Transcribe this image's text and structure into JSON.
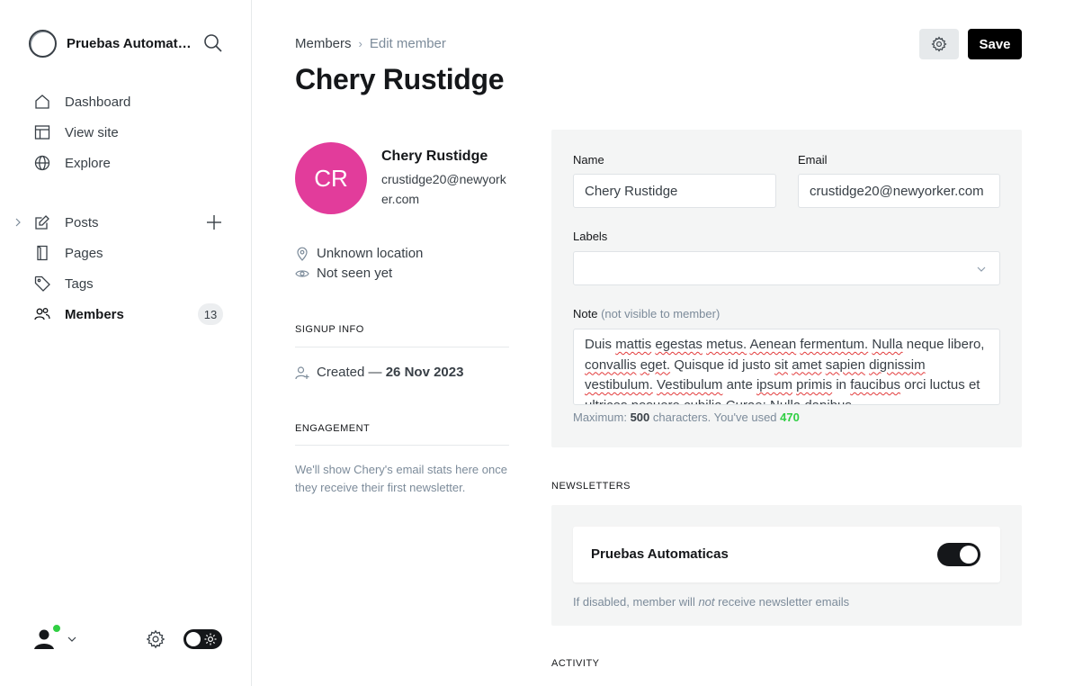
{
  "sidebar": {
    "site_name": "Pruebas Automaticas",
    "nav_primary": [
      {
        "label": "Dashboard",
        "icon": "home-icon"
      },
      {
        "label": "View site",
        "icon": "layout-icon"
      },
      {
        "label": "Explore",
        "icon": "globe-icon"
      }
    ],
    "nav_secondary": [
      {
        "label": "Posts",
        "icon": "pen-icon"
      },
      {
        "label": "Pages",
        "icon": "page-icon"
      },
      {
        "label": "Tags",
        "icon": "tag-icon"
      },
      {
        "label": "Members",
        "icon": "members-icon",
        "count": "13",
        "active": true
      }
    ]
  },
  "header": {
    "breadcrumb_parent": "Members",
    "breadcrumb_separator": "›",
    "breadcrumb_current": "Edit member",
    "title": "Chery Rustidge",
    "save_label": "Save"
  },
  "member": {
    "initials": "CR",
    "avatar_color": "#e23c9b",
    "name": "Chery Rustidge",
    "email": "crustidge20@newyorker.com",
    "location": "Unknown location",
    "last_seen": "Not seen yet",
    "signup_section": "SIGNUP INFO",
    "created_prefix": "Created —",
    "created_date": "26 Nov 2023",
    "engagement_section": "ENGAGEMENT",
    "engagement_text": "We'll show Chery's email stats here once they receive their first newsletter."
  },
  "form": {
    "name_label": "Name",
    "name_value": "Chery Rustidge",
    "email_label": "Email",
    "email_value": "crustidge20@newyorker.com",
    "labels_label": "Labels",
    "note_label": "Note",
    "note_hint": "(not visible to member)",
    "note_value": "Duis mattis egestas metus. Aenean fermentum. Nulla neque libero, convallis eget. Quisque id justo sit amet sapien dignissim vestibulum. Vestibulum ante ipsum primis in faucibus orci luctus et ultrices posuere cubilia Curae; Nulla dapibus",
    "counter_prefix": "Maximum:",
    "counter_max": "500",
    "counter_mid": "characters. You've used",
    "counter_used": "470"
  },
  "newsletters": {
    "section": "NEWSLETTERS",
    "items": [
      {
        "name": "Pruebas Automaticas",
        "subscribed": true
      }
    ],
    "hint_before": "If disabled, member will",
    "hint_em": "not",
    "hint_after": "receive newsletter emails"
  },
  "activity": {
    "section": "ACTIVITY"
  },
  "colors": {
    "accent": "#30cf43",
    "dark": "#15171a",
    "avatar": "#e23c9b"
  }
}
